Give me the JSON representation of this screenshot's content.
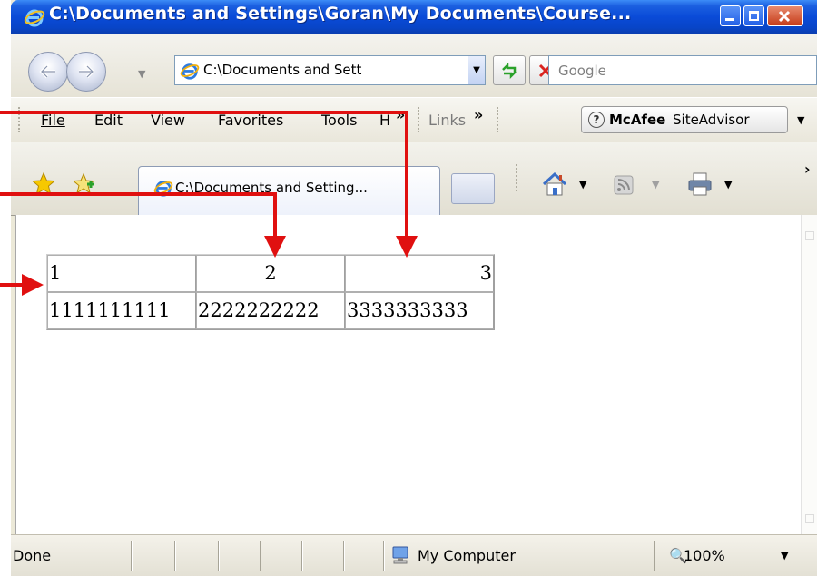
{
  "window": {
    "title": "C:\\Documents and Settings\\Goran\\My Documents\\Course..."
  },
  "navbar": {
    "address": "C:\\Documents and Sett",
    "search_placeholder": "Google"
  },
  "menubar": {
    "items": [
      "File",
      "Edit",
      "View",
      "Favorites",
      "Tools",
      "H",
      "»",
      "Links",
      "»"
    ],
    "mcafee_brand": "McAfee",
    "mcafee_rest": "SiteAdvisor"
  },
  "tab": {
    "title": "C:\\Documents and Setting..."
  },
  "table": {
    "header_row": [
      "1",
      "2",
      "3"
    ],
    "header_align": [
      "left",
      "center",
      "right"
    ],
    "data_row": [
      "1111111111",
      "2222222222",
      "3333333333"
    ]
  },
  "statusbar": {
    "status": "Done",
    "zone": "My Computer",
    "zoom": "100%"
  },
  "colors": {
    "titlebar": "#0a4bd8",
    "annotation_arrow": "#e01010"
  }
}
